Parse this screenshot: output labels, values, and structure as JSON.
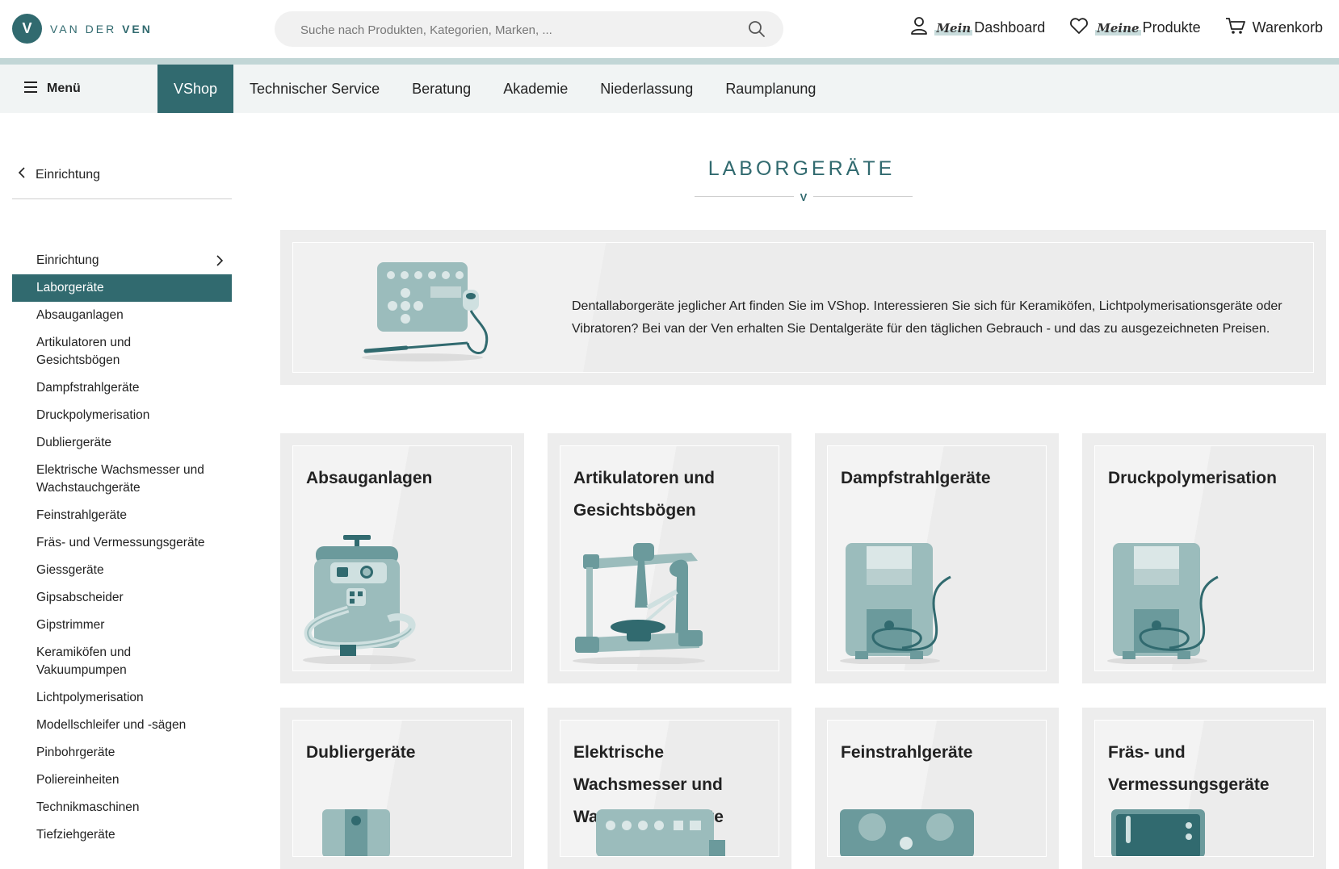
{
  "header": {
    "logo_letter": "V",
    "logo_text_prefix": "VAN DER",
    "logo_text_suffix": "VEN",
    "search_placeholder": "Suche nach Produkten, Kategorien, Marken, ...",
    "links": [
      {
        "script": "Mein",
        "label": "Dashboard",
        "icon": "user-icon"
      },
      {
        "script": "Meine",
        "label": "Produkte",
        "icon": "heart-icon"
      },
      {
        "script": "",
        "label": "Warenkorb",
        "icon": "cart-icon"
      }
    ]
  },
  "nav": {
    "menu_label": "Menü",
    "items": [
      "VShop",
      "Technischer Service",
      "Beratung",
      "Akademie",
      "Niederlassung",
      "Raumplanung"
    ],
    "active": "VShop"
  },
  "sidebar": {
    "back_label": "Einrichtung",
    "items": [
      "Einrichtung",
      "Laborgeräte",
      "Absauganlagen",
      "Artikulatoren und Gesichtsbögen",
      "Dampfstrahlgeräte",
      "Druckpolymerisation",
      "Dubliergeräte",
      "Elektrische Wachsmesser und Wachstauchgeräte",
      "Feinstrahlgeräte",
      "Fräs- und Vermessungsgeräte",
      "Giessgeräte",
      "Gipsabscheider",
      "Gipstrimmer",
      "Keramiköfen und Vakuumpumpen",
      "Lichtpolymerisation",
      "Modellschleifer und -sägen",
      "Pinbohrgeräte",
      "Poliereinheiten",
      "Technikmaschinen",
      "Tiefziehgeräte"
    ],
    "active": "Laborgeräte"
  },
  "main": {
    "title": "LABORGERÄTE",
    "title_mark": "V",
    "banner_text": "Dentallaborgeräte jeglicher Art finden Sie im VShop. Interessieren Sie sich für Keramiköfen, Lichtpolymerisationsgeräte oder Vibratoren? Bei van der Ven erhalten Sie Dentalgeräte für den täglichen Gebrauch - und das zu ausgezeichneten Preisen.",
    "categories": [
      "Absauganlagen",
      "Artikulatoren und Gesichtsbögen",
      "Dampfstrahlgeräte",
      "Druckpolymerisation",
      "Dubliergeräte",
      "Elektrische Wachsmesser und Wachstauchgeräte",
      "Feinstrahlgeräte",
      "Fräs- und Vermessungsgeräte"
    ]
  },
  "colors": {
    "brand": "#316a6f",
    "stripe": "#c2d6d6",
    "nav_bg": "#f1f4f4",
    "card_bg": "#ededed"
  }
}
